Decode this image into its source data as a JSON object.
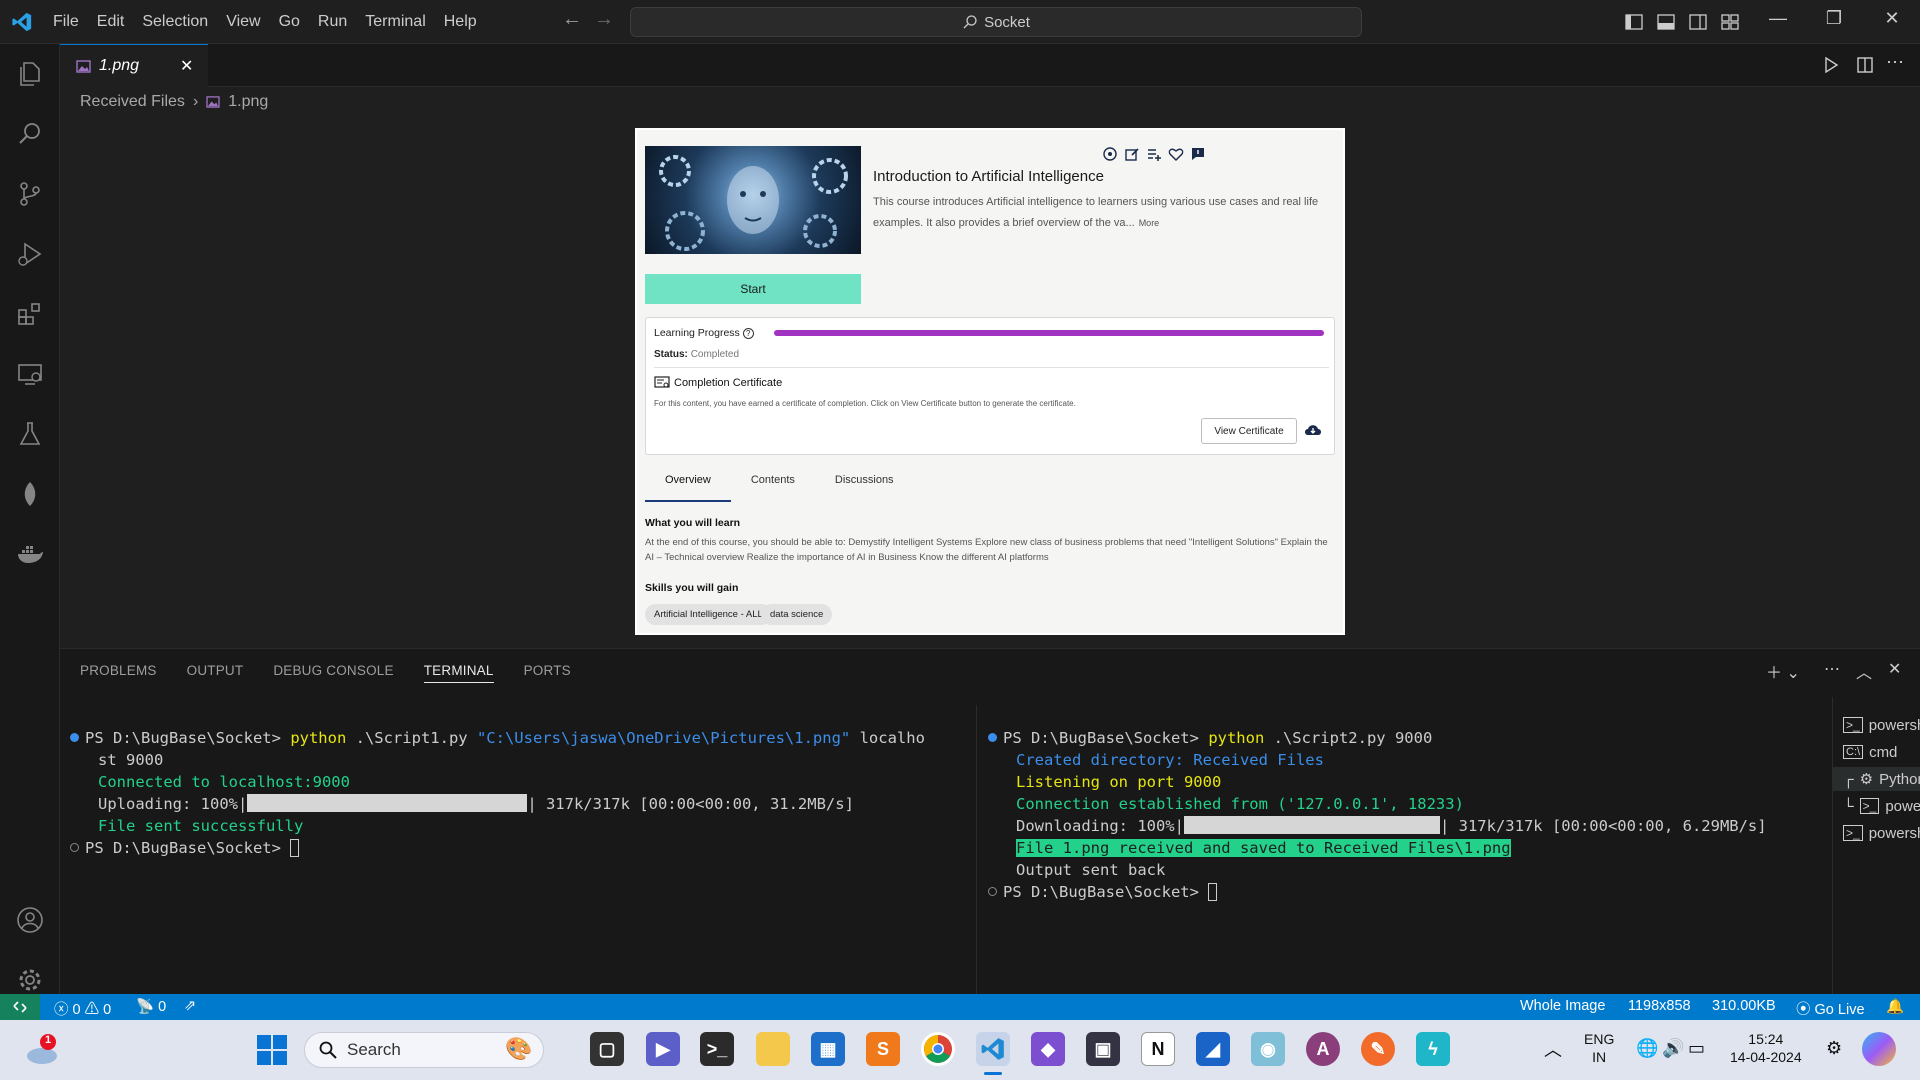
{
  "titlebar": {
    "menu": [
      "File",
      "Edit",
      "Selection",
      "View",
      "Go",
      "Run",
      "Terminal",
      "Help"
    ],
    "search": "Socket"
  },
  "editor": {
    "tab_label": "1.png",
    "breadcrumb": [
      "Received Files",
      "1.png"
    ]
  },
  "preview": {
    "course_title": "Introduction to Artificial Intelligence",
    "course_desc": "This course introduces Artificial intelligence to learners using various use cases and real life examples. It also provides a brief overview of the va...",
    "more_link": "More",
    "start_label": "Start",
    "learning_progress_label": "Learning Progress",
    "progress": 1.0,
    "progress_color": "#a033c0",
    "status_label": "Status:",
    "status_value": "Completed",
    "cert_title": "Completion Certificate",
    "cert_desc": "For this content, you have earned a certificate of completion. Click on View Certificate button to generate the certificate.",
    "view_cert_label": "View Certificate",
    "tabs": [
      "Overview",
      "Contents",
      "Discussions"
    ],
    "learn_title": "What you will learn",
    "learn_body": "At the end of this course, you should be able to: Demystify Intelligent Systems Explore new class of business problems that need \"Intelligent Solutions\" Explain the AI – Technical overview Realize the importance of AI in Business Know the different AI platforms",
    "skills_title": "Skills you will gain",
    "skills": [
      "Artificial Intelligence - ALL",
      "data science"
    ]
  },
  "panel": {
    "tabs": [
      "PROBLEMS",
      "OUTPUT",
      "DEBUG CONSOLE",
      "TERMINAL",
      "PORTS"
    ],
    "active_tab": "TERMINAL"
  },
  "terminal_left": {
    "prompt1": "PS D:\\BugBase\\Socket> ",
    "cmd": "python",
    "args1": " .\\Script1.py ",
    "path_arg": "\"C:\\Users\\jaswa\\OneDrive\\Pictures\\1.png\"",
    "args2": " localho",
    "args_wrap": "st 9000",
    "connected": "Connected to localhost:9000",
    "uploading": "Uploading: 100%|",
    "upload_stats": "| 317k/317k [00:00<00:00, 31.2MB/s]",
    "sent": "File sent successfully",
    "prompt2": "PS D:\\BugBase\\Socket> "
  },
  "terminal_right": {
    "prompt1": "PS D:\\BugBase\\Socket> ",
    "cmd": "python",
    "args": " .\\Script2.py 9000",
    "created": "Created directory: Received Files",
    "listening": "Listening on port 9000",
    "connection": "Connection established from ('127.0.0.1', 18233)",
    "downloading": "Downloading: 100%|",
    "download_stats": "| 317k/317k [00:00<00:00, 6.29MB/s]",
    "received": "File 1.png received and saved to Received Files\\1.png",
    "output_back": "Output sent back",
    "prompt2": "PS D:\\BugBase\\Socket> "
  },
  "terminal_list": [
    "powershell",
    "cmd",
    "Python D...",
    "powershell",
    "powershell"
  ],
  "statusbar": {
    "errors": "0",
    "warnings": "0",
    "ports": "0",
    "whole_image": "Whole Image",
    "dimensions": "1198x858",
    "size": "310.00KB",
    "go_live": "Go Live"
  },
  "taskbar": {
    "search": "Search",
    "notification_count": "1",
    "lang1": "ENG",
    "lang2": "IN",
    "time": "15:24",
    "date": "14-04-2024"
  },
  "colors": {
    "accent": "#007acc",
    "terminal_green": "#23d18b",
    "terminal_yellow": "#e5e510",
    "terminal_blue": "#3b8eea"
  }
}
